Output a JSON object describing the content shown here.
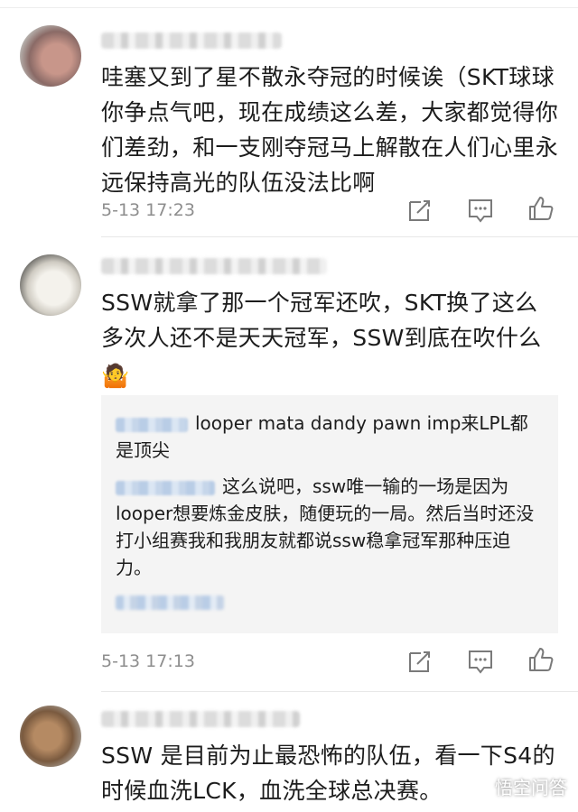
{
  "comments": [
    {
      "text": "哇塞又到了星不散永夺冠的时候诶（SKT球球你争点气吧，现在成绩这么差，大家都觉得你们差劲，和一支刚夺冠马上解散在人们心里永远保持高光的队伍没法比啊",
      "time": "5-13 17:23"
    },
    {
      "text": "SSW就拿了那一个冠军还吹，SKT换了这么多次人还不是天天冠军，SSW到底在吹什么",
      "emoji": "🤷",
      "time": "5-13 17:13",
      "replies": [
        {
          "text": "looper mata dandy pawn imp来LPL都是顶尖"
        },
        {
          "text": "这么说吧，ssw唯一输的一场是因为looper想要炼金皮肤，随便玩的一局。然后当时还没打小组赛我和我朋友就都说ssw稳拿冠军那种压迫力。"
        }
      ]
    },
    {
      "text": "SSW 是目前为止最恐怖的队伍，看一下S4的时候血洗LCK，血洗全球总决赛。"
    }
  ],
  "watermark": "悟空问答",
  "icons": {
    "share": "share-icon",
    "comment": "comment-icon",
    "like": "thumbs-up-icon"
  }
}
